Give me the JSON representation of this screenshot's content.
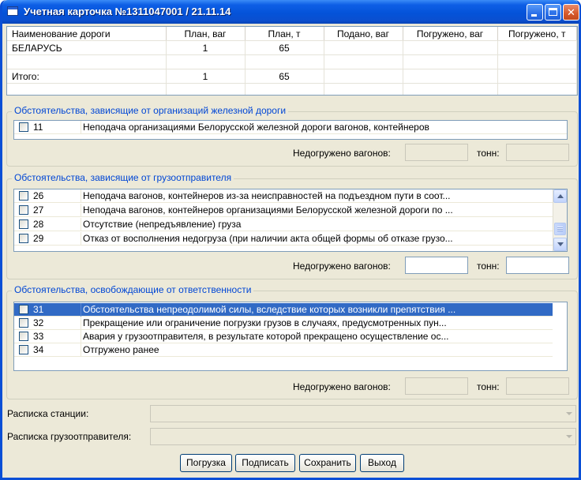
{
  "window": {
    "title": "Учетная карточка №1311047001 / 21.11.14",
    "minimize_label": "_",
    "maximize_label": "□",
    "close_label": "✕"
  },
  "summary": {
    "columns": [
      "Наименование дороги",
      "План, ваг",
      "План, т",
      "Подано, ваг",
      "Погружено, ваг",
      "Погружено, т"
    ],
    "rows": [
      [
        "БЕЛАРУСЬ",
        "1",
        "65",
        "",
        "",
        ""
      ],
      [
        "",
        "",
        "",
        "",
        "",
        ""
      ],
      [
        "Итого:",
        "1",
        "65",
        "",
        "",
        ""
      ],
      [
        "",
        "",
        "",
        "",
        "",
        ""
      ]
    ]
  },
  "railway_group": {
    "title": "Обстоятельства, зависящие от организаций железной дороги",
    "items": [
      {
        "code": "11",
        "text": "Неподача организациями Белорусской железной дороги вагонов, контейнеров"
      }
    ],
    "undelivered_wagons_label": "Недогружено вагонов:",
    "tons_label": "тонн:"
  },
  "shipper_group": {
    "title": "Обстоятельства, зависящие от грузоотправителя",
    "items": [
      {
        "code": "26",
        "text": "Неподача вагонов, контейнеров из-за неисправностей на подъездном пути в соот..."
      },
      {
        "code": "27",
        "text": "Неподача вагонов, контейнеров организациями Белорусской железной дороги по ..."
      },
      {
        "code": "28",
        "text": "Отсутствие (непредъявление) груза"
      },
      {
        "code": "29",
        "text": "Отказ от восполнения недогруза (при наличии акта общей формы об отказе грузо..."
      }
    ],
    "undelivered_wagons_label": "Недогружено вагонов:",
    "tons_label": "тонн:"
  },
  "release_group": {
    "title": "Обстоятельства, освобождающие от ответственности",
    "items": [
      {
        "code": "31",
        "text": "Обстоятельства непреодолимой силы, вследствие которых возникли препятствия ..."
      },
      {
        "code": "32",
        "text": "Прекращение или ограничение погрузки грузов в случаях, предусмотренных пун..."
      },
      {
        "code": "33",
        "text": "Авария у грузоотправителя, в результате которой прекращено осуществление ос..."
      },
      {
        "code": "34",
        "text": "Отгружено ранее"
      }
    ],
    "undelivered_wagons_label": "Недогружено вагонов:",
    "tons_label": "тонн:"
  },
  "receipts": {
    "station_label": "Расписка станции:",
    "shipper_label": "Расписка грузоотправителя:"
  },
  "buttons": {
    "load": "Погрузка",
    "sign": "Подписать",
    "save": "Сохранить",
    "exit": "Выход"
  }
}
